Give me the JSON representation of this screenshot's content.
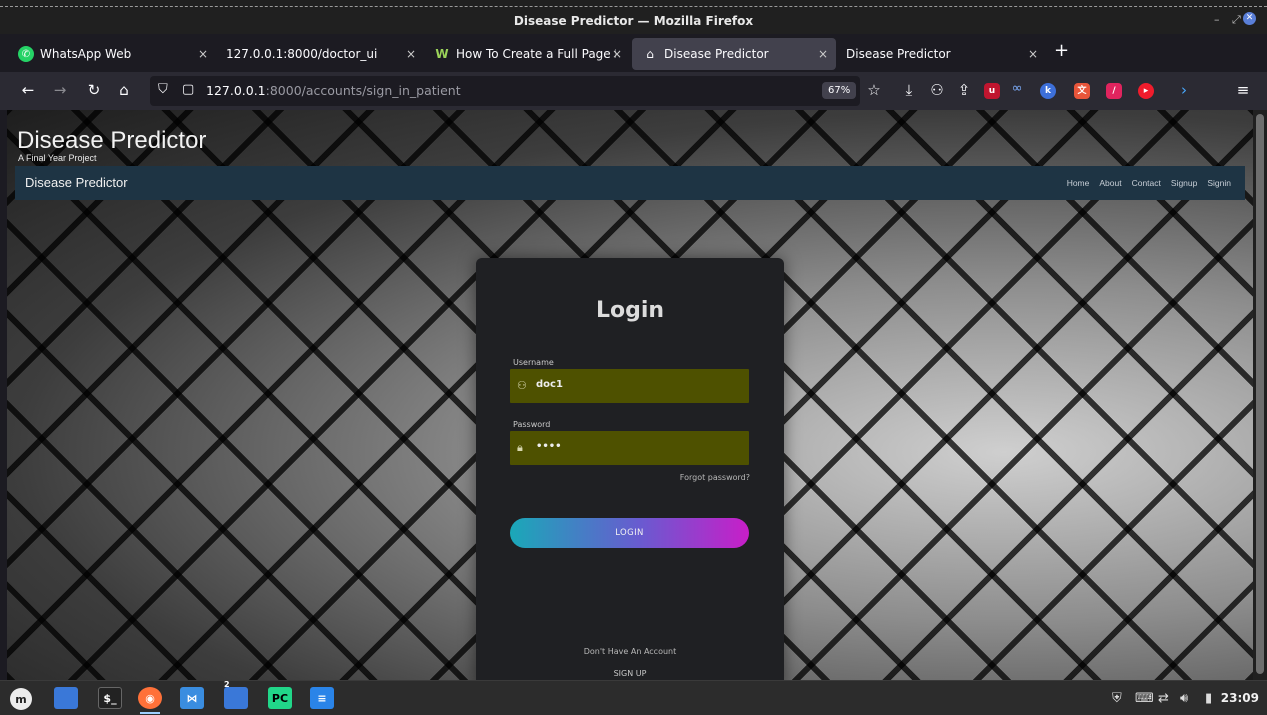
{
  "window": {
    "title": "Disease Predictor — Mozilla Firefox"
  },
  "tabs": [
    {
      "label": "WhatsApp Web",
      "icon": "whatsapp-icon"
    },
    {
      "label": "127.0.0.1:8000/doctor_ui",
      "icon": ""
    },
    {
      "label": "How To Create a Full Page I",
      "icon": "w-logo-icon"
    },
    {
      "label": "Disease Predictor",
      "icon": "home-icon",
      "active": true
    },
    {
      "label": "Disease Predictor",
      "icon": ""
    }
  ],
  "tab_close_glyph": "×",
  "new_tab_glyph": "+",
  "address": {
    "host": "127.0.0.1",
    "path": ":8000/accounts/sign_in_patient"
  },
  "zoom_level": "67%",
  "site": {
    "title": "Disease Predictor",
    "subtitle": "A Final Year Project",
    "nav_brand": "Disease Predictor",
    "nav_links": [
      "Home",
      "About",
      "Contact",
      "Signup",
      "Signin"
    ]
  },
  "login": {
    "heading": "Login",
    "username_label": "Username",
    "username_value": "doc1",
    "password_label": "Password",
    "password_value": "••••",
    "forgot_label": "Forgot password?",
    "button_label": "LOGIN",
    "no_account_text": "Don't Have An Account",
    "signup_label": "SIGN UP"
  },
  "taskbar": {
    "clock": "23:09",
    "workspace_badge": "2"
  },
  "colors": {
    "accent_start": "#1aa8b8",
    "accent_end": "#c81ec8",
    "field_bg": "#4e5100",
    "site_nav_bg": "#1e3444"
  }
}
